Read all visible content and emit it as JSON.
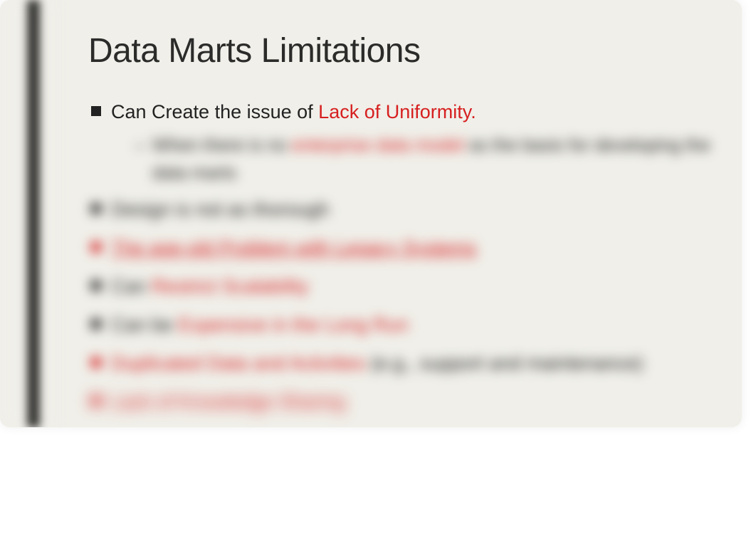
{
  "title": "Data Marts Limitations",
  "bullet1_prefix": "Can Create the issue of ",
  "bullet1_red": "Lack of Uniformity.",
  "sub1_part1": "When there is no ",
  "sub1_red": "enterprise data model ",
  "sub1_part2": "as the basis for developing the data marts",
  "bullet2": "Design is not as thorough",
  "bullet3_red": "The age-old Problem with Legacy Systems",
  "bullet4_prefix": "Can ",
  "bullet4_red": "Restrict Scalability",
  "bullet5_prefix": "Can be ",
  "bullet5_red": "Expensive in the Long Run",
  "bullet6_red": "Duplicated Data and Activities ",
  "bullet6_suffix": "(e.g., support and maintenance)",
  "bullet7_red": "Lack of Knowledge Sharing"
}
